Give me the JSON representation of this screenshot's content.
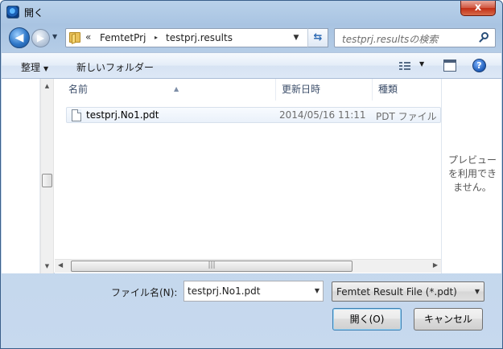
{
  "window": {
    "title": "開く",
    "close_label": "x"
  },
  "nav": {
    "back_glyph": "◀",
    "forward_glyph": "▶"
  },
  "address": {
    "chevron": "«",
    "segments": [
      "FemtetPrj",
      "testprj.results"
    ],
    "separator": "▸"
  },
  "search": {
    "placeholder": "testprj.resultsの検索"
  },
  "toolbar": {
    "organize_label": "整理",
    "new_folder_label": "新しいフォルダー",
    "help_label": "?"
  },
  "columns": {
    "name": "名前",
    "date": "更新日時",
    "type": "種類"
  },
  "files": [
    {
      "name": "testprj.No1.pdt",
      "date": "2014/05/16 11:11",
      "type": "PDT ファイル"
    }
  ],
  "preview": {
    "text": "プレビューを利用できません。"
  },
  "filename": {
    "label": "ファイル名(N):",
    "value": "testprj.No1.pdt"
  },
  "filetype": {
    "selected": "Femtet Result File (*.pdt)"
  },
  "buttons": {
    "open_label": "開く(O)",
    "cancel_label": "キャンセル"
  },
  "icons": {
    "app": "globe-icon",
    "folder": "folder-icon",
    "refresh": "refresh-icon",
    "search": "search-icon",
    "views": "view-details-icon",
    "preview_pane": "preview-pane-icon",
    "help": "help-icon",
    "file": "document-icon"
  },
  "colors": {
    "accent": "#3c7fb1",
    "close": "#c22e15",
    "frame": "#b9d1ea"
  }
}
